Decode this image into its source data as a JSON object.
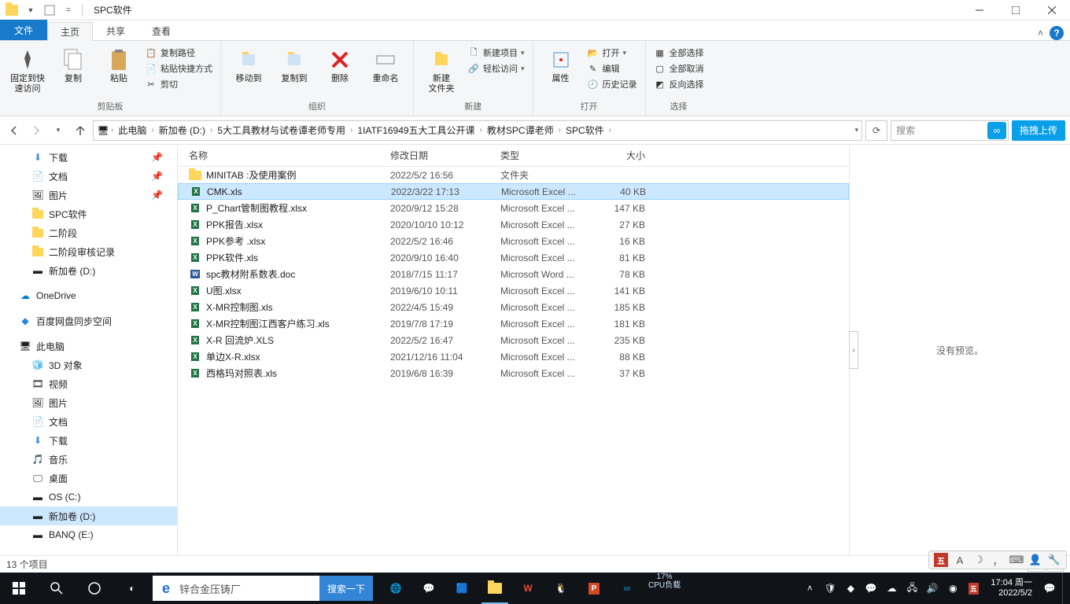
{
  "window": {
    "title": "SPC软件"
  },
  "tabs": {
    "file": "文件",
    "home": "主页",
    "share": "共享",
    "view": "查看"
  },
  "ribbon": {
    "clipboard": {
      "pin": "固定到快\n速访问",
      "copy": "复制",
      "paste": "粘贴",
      "copy_path": "复制路径",
      "paste_shortcut": "粘贴快捷方式",
      "cut": "剪切",
      "label": "剪贴板"
    },
    "organize": {
      "move_to": "移动到",
      "copy_to": "复制到",
      "delete": "删除",
      "rename": "重命名",
      "label": "组织"
    },
    "new": {
      "new_folder": "新建\n文件夹",
      "new_item": "新建项目",
      "easy_access": "轻松访问",
      "label": "新建"
    },
    "open": {
      "properties": "属性",
      "open": "打开",
      "edit": "编辑",
      "history": "历史记录",
      "label": "打开"
    },
    "select": {
      "select_all": "全部选择",
      "select_none": "全部取消",
      "invert": "反向选择",
      "label": "选择"
    }
  },
  "breadcrumbs": [
    "此电脑",
    "新加卷 (D:)",
    "5大工具教材与试卷谭老师专用",
    "1IATF16949五大工具公开课",
    "教材SPC谭老师",
    "SPC软件"
  ],
  "search_placeholder": "搜索",
  "upload_label": "拖拽上传",
  "columns": {
    "name": "名称",
    "date": "修改日期",
    "type": "类型",
    "size": "大小"
  },
  "tree": {
    "downloads": "下载",
    "documents": "文档",
    "pictures": "图片",
    "spc": "SPC软件",
    "stage2": "二阶段",
    "audit": "二阶段审核记录",
    "newvol": "新加卷 (D:)",
    "onedrive": "OneDrive",
    "baidu": "百度网盘同步空间",
    "thispc": "此电脑",
    "objects3d": "3D 对象",
    "videos": "视频",
    "pictures2": "图片",
    "documents2": "文档",
    "downloads2": "下载",
    "music": "音乐",
    "desktop": "桌面",
    "osc": "OS (C:)",
    "newvold": "新加卷 (D:)",
    "banq": "BANQ (E:)"
  },
  "files": [
    {
      "name": "MINITAB      :及使用案例",
      "date": "2022/5/2 16:56",
      "type": "文件夹",
      "size": "",
      "kind": "folder"
    },
    {
      "name": "CMK.xls",
      "date": "2022/3/22 17:13",
      "type": "Microsoft Excel ...",
      "size": "40 KB",
      "kind": "xls",
      "selected": true
    },
    {
      "name": "P_Chart管制图教程.xlsx",
      "date": "2020/9/12 15:28",
      "type": "Microsoft Excel ...",
      "size": "147 KB",
      "kind": "xlsx"
    },
    {
      "name": "PPK报告.xlsx",
      "date": "2020/10/10 10:12",
      "type": "Microsoft Excel ...",
      "size": "27 KB",
      "kind": "xlsx"
    },
    {
      "name": "PPK参考 .xlsx",
      "date": "2022/5/2 16:46",
      "type": "Microsoft Excel ...",
      "size": "16 KB",
      "kind": "xlsx"
    },
    {
      "name": "PPK软件.xls",
      "date": "2020/9/10 16:40",
      "type": "Microsoft Excel ...",
      "size": "81 KB",
      "kind": "xls"
    },
    {
      "name": "spc教材附系数表.doc",
      "date": "2018/7/15 11:17",
      "type": "Microsoft Word ...",
      "size": "78 KB",
      "kind": "doc"
    },
    {
      "name": "U图.xlsx",
      "date": "2019/6/10 10:11",
      "type": "Microsoft Excel ...",
      "size": "141 KB",
      "kind": "xlsx"
    },
    {
      "name": "X-MR控制图.xls",
      "date": "2022/4/5 15:49",
      "type": "Microsoft Excel ...",
      "size": "185 KB",
      "kind": "xls"
    },
    {
      "name": "X-MR控制图江西客户练习.xls",
      "date": "2019/7/8 17:19",
      "type": "Microsoft Excel ...",
      "size": "181 KB",
      "kind": "xls"
    },
    {
      "name": "X-R 回流炉.XLS",
      "date": "2022/5/2 16:47",
      "type": "Microsoft Excel ...",
      "size": "235 KB",
      "kind": "xls"
    },
    {
      "name": "单边X-R.xlsx",
      "date": "2021/12/16 11:04",
      "type": "Microsoft Excel ...",
      "size": "88 KB",
      "kind": "xlsx"
    },
    {
      "name": "西格玛对照表.xls",
      "date": "2019/6/8 16:39",
      "type": "Microsoft Excel ...",
      "size": "37 KB",
      "kind": "xls"
    }
  ],
  "preview_text": "没有预览。",
  "status_text": "13 个项目",
  "taskbar": {
    "search_text": "锌合金压铸厂",
    "search_go": "搜索一下",
    "cpu_pct": "17%",
    "cpu_label": "CPU负载",
    "time": "17:04",
    "weekday": "周一",
    "date": "2022/5/2"
  }
}
